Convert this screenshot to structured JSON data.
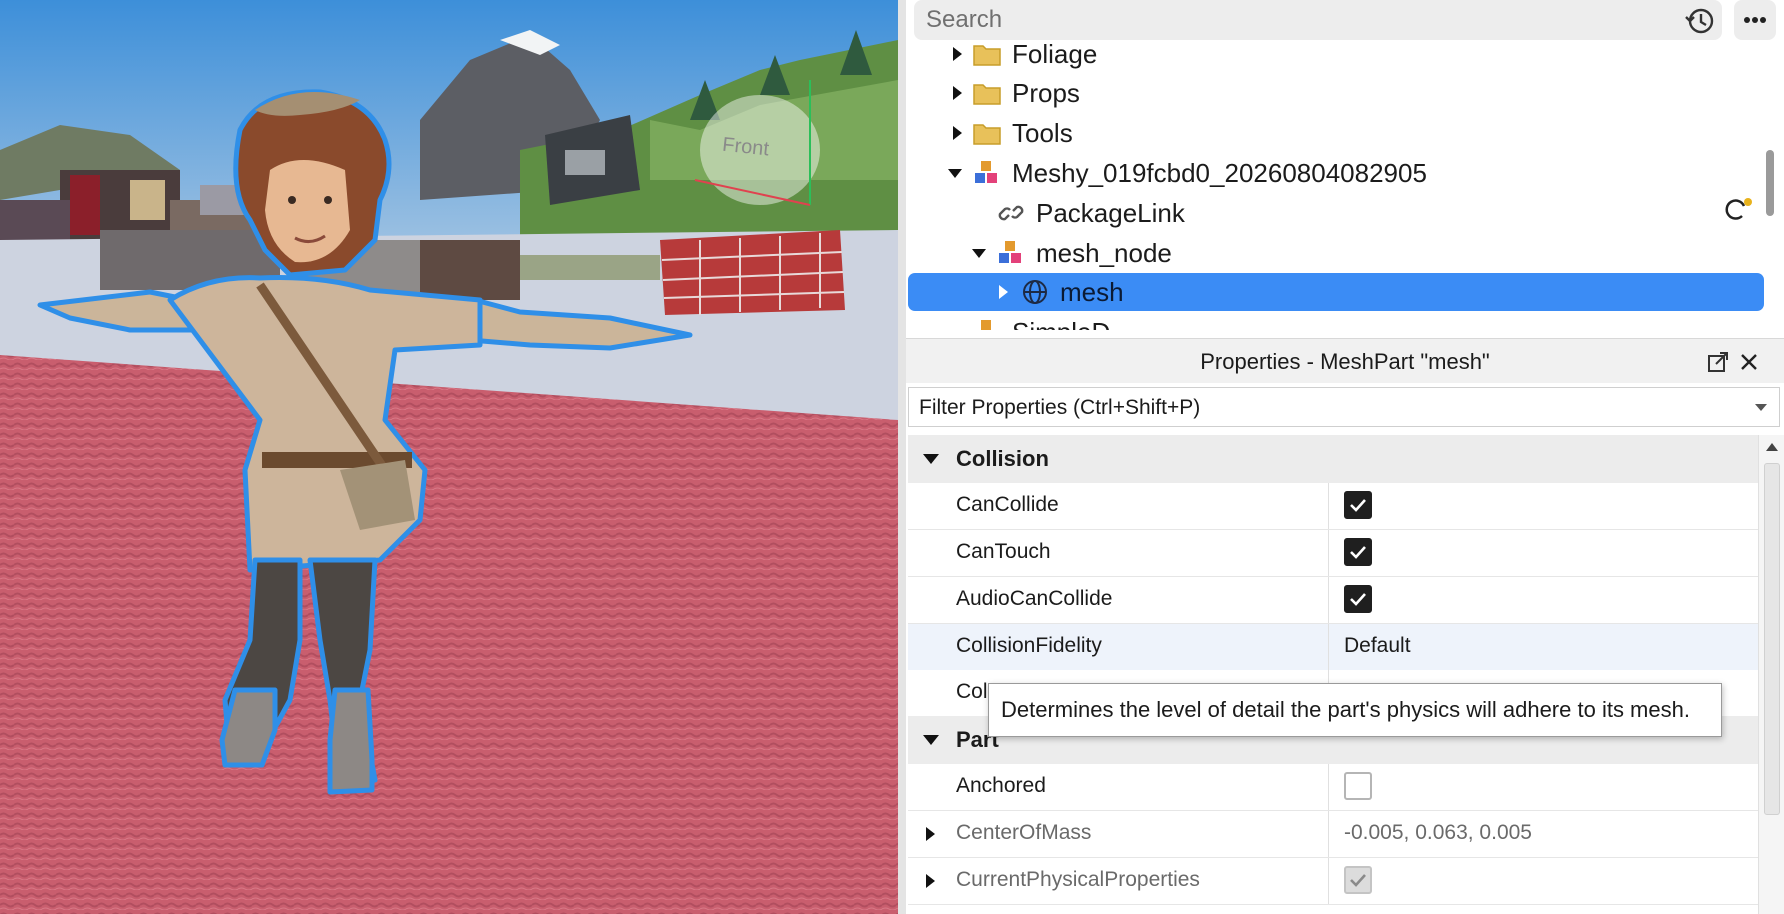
{
  "viewport": {
    "gizmo_label": "Front"
  },
  "explorer": {
    "search_placeholder": "Search",
    "items": [
      {
        "label": "Foliage",
        "icon": "folder-icon",
        "expanded": false
      },
      {
        "label": "Props",
        "icon": "folder-icon",
        "expanded": false
      },
      {
        "label": "Tools",
        "icon": "folder-icon",
        "expanded": false
      },
      {
        "label": "Meshy_019fcbd0_20260804082905",
        "icon": "model-icon",
        "expanded": true
      },
      {
        "label": "PackageLink",
        "icon": "link-icon",
        "expanded": false
      },
      {
        "label": "mesh_node",
        "icon": "model-icon",
        "expanded": true
      },
      {
        "label": "mesh",
        "icon": "meshpart-icon",
        "expanded": false,
        "selected": true
      },
      {
        "label": "SimpleD...",
        "icon": "model-icon",
        "expanded": false
      }
    ]
  },
  "properties": {
    "title": "Properties - MeshPart \"mesh\"",
    "filter_placeholder": "Filter Properties (Ctrl+Shift+P)",
    "categories": [
      {
        "name": "Collision",
        "rows": [
          {
            "name": "CanCollide",
            "type": "checkbox",
            "checked": true
          },
          {
            "name": "CanTouch",
            "type": "checkbox",
            "checked": true
          },
          {
            "name": "AudioCanCollide",
            "type": "checkbox",
            "checked": true
          },
          {
            "name": "CollisionFidelity",
            "type": "text",
            "value": "Default"
          },
          {
            "name": "Col",
            "type": "text",
            "value": ""
          }
        ]
      },
      {
        "name": "Part",
        "rows": [
          {
            "name": "Anchored",
            "type": "checkbox",
            "checked": false
          },
          {
            "name": "CenterOfMass",
            "type": "text",
            "value": "-0.005, 0.063, 0.005"
          },
          {
            "name": "CurrentPhysicalProperties",
            "type": "checkbox",
            "checked": true
          }
        ]
      }
    ]
  },
  "tooltip": {
    "text": "Determines the level of detail the part's physics will adhere to its mesh."
  },
  "colors": {
    "selection": "#3b8cf5",
    "outline": "#2f8fe8",
    "ground": "#c95e6e"
  }
}
